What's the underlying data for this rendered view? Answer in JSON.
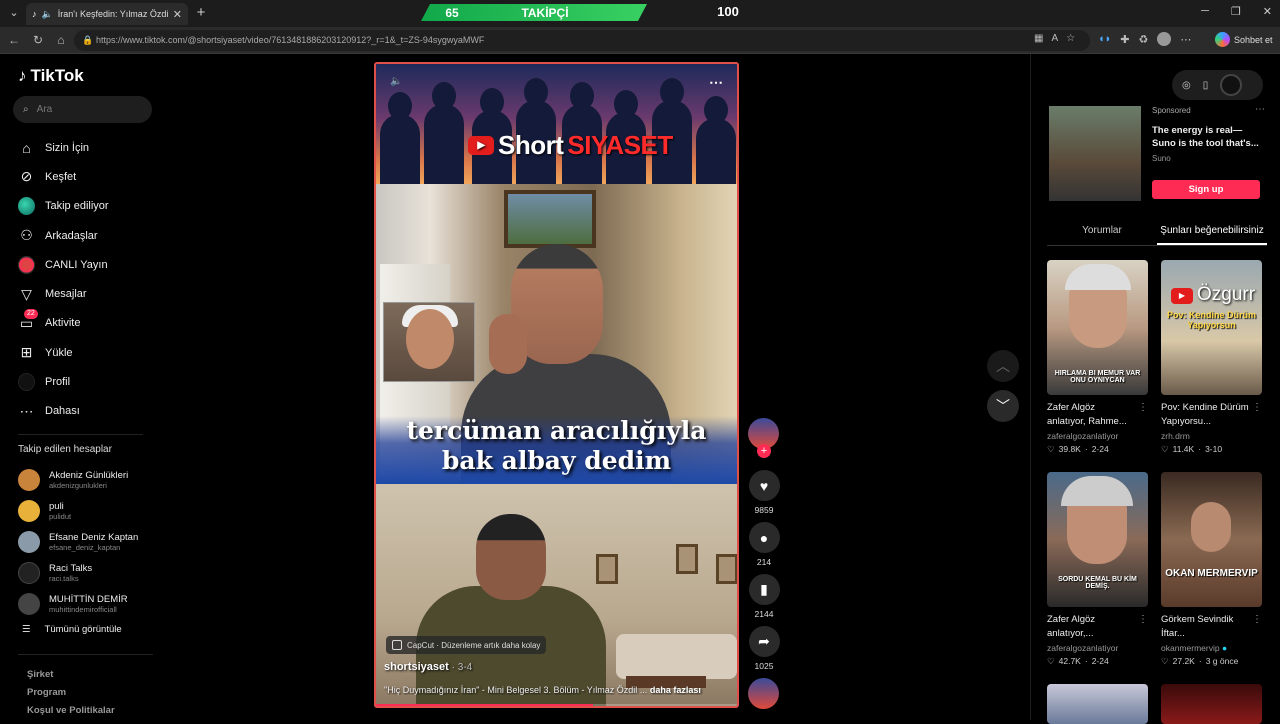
{
  "browser": {
    "tab_title": "İran'ı Keşfedin: Yılmaz Özdil ile",
    "url": "https://www.tiktok.com/@shortsiyaset/video/7613481886203120912?_r=1&_t=ZS-94sygwyaMWF",
    "chat_label": "Sohbet et"
  },
  "overlay": {
    "followers": "65",
    "label": "TAKİPÇİ",
    "goal": "100"
  },
  "sidebar": {
    "logo": "TikTok",
    "search_placeholder": "Ara",
    "nav": [
      {
        "label": "Sizin İçin",
        "icon": "home-icon"
      },
      {
        "label": "Keşfet",
        "icon": "compass-icon"
      },
      {
        "label": "Takip ediliyor",
        "icon": "following-icon"
      },
      {
        "label": "Arkadaşlar",
        "icon": "friends-icon"
      },
      {
        "label": "CANLI Yayın",
        "icon": "live-icon"
      },
      {
        "label": "Mesajlar",
        "icon": "send-icon"
      },
      {
        "label": "Aktivite",
        "icon": "activity-icon",
        "badge": "22"
      },
      {
        "label": "Yükle",
        "icon": "upload-icon"
      },
      {
        "label": "Profil",
        "icon": "profile-icon"
      },
      {
        "label": "Dahası",
        "icon": "more-icon"
      }
    ],
    "following_title": "Takip edilen hesaplar",
    "accounts": [
      {
        "name": "Akdeniz Günlükleri",
        "handle": "akdenizgunlukleri",
        "color": "#c8843a"
      },
      {
        "name": "puli",
        "handle": "pulidut",
        "color": "#e8b23a"
      },
      {
        "name": "Efsane Deniz Kaptan",
        "handle": "efsane_deniz_kaptan",
        "color": "#8a9aa8"
      },
      {
        "name": "Raci Talks",
        "handle": "raci.talks",
        "color": "#222222"
      },
      {
        "name": "MUHİTTİN DEMİR",
        "handle": "muhittindemirofficiall",
        "color": "#444444"
      }
    ],
    "see_all": "Tümünü görüntüle",
    "footer": [
      "Şirket",
      "Program",
      "Koşul ve Politikalar"
    ]
  },
  "video": {
    "channel_logo_a": "Short",
    "channel_logo_b": "SIYASET",
    "caption_line1": "tercüman aracılığıyla",
    "caption_line2": "bak albay dedim",
    "capcut": "CapCut · Düzenleme artık daha kolay",
    "username": "shortsiyaset",
    "date": " · 3-4",
    "description": "\"Hiç Duymadığınız İran\" - Mini Belgesel 3. Bölüm - Yılmaz Özdil ...",
    "more": "daha fazlası",
    "progress": 0.6
  },
  "actions": {
    "likes": "9859",
    "comments": "214",
    "saves": "2144",
    "shares": "1025"
  },
  "right": {
    "ad": {
      "sponsored": "Sponsored",
      "text": "The energy is real—Suno is the tool that's...",
      "source": "Suno",
      "button": "Sign up"
    },
    "tabs": [
      "Yorumlar",
      "Şunları beğenebilirsiniz"
    ],
    "cards": [
      {
        "title": "Zafer Algöz anlatıyor, Rahme...",
        "user": "zaferalgozanlatiyor",
        "likes": "39.8K",
        "date": "2-24",
        "overlay": "HIRLAMA BI MEMUR VAR ONU OYNIYCAN"
      },
      {
        "title": "Pov: Kendine Dürüm Yapıyorsu...",
        "user": "zrh.drm",
        "likes": "11.4K",
        "date": "3-10",
        "overlay": "Pov: Kendine Dürüm Yapıyorsun"
      },
      {
        "title": "Zafer Algöz anlatıyor,...",
        "user": "zaferalgozanlatiyor",
        "likes": "42.7K",
        "date": "2-24",
        "overlay": "SORDU KEMAL BU KİM DEMİŞ."
      },
      {
        "title": "Görkem Sevindik İftar...",
        "user": "okanmermervip",
        "likes": "27.2K",
        "date": "3 g önce",
        "overlay": "OKAN MERMERVIP"
      }
    ]
  }
}
